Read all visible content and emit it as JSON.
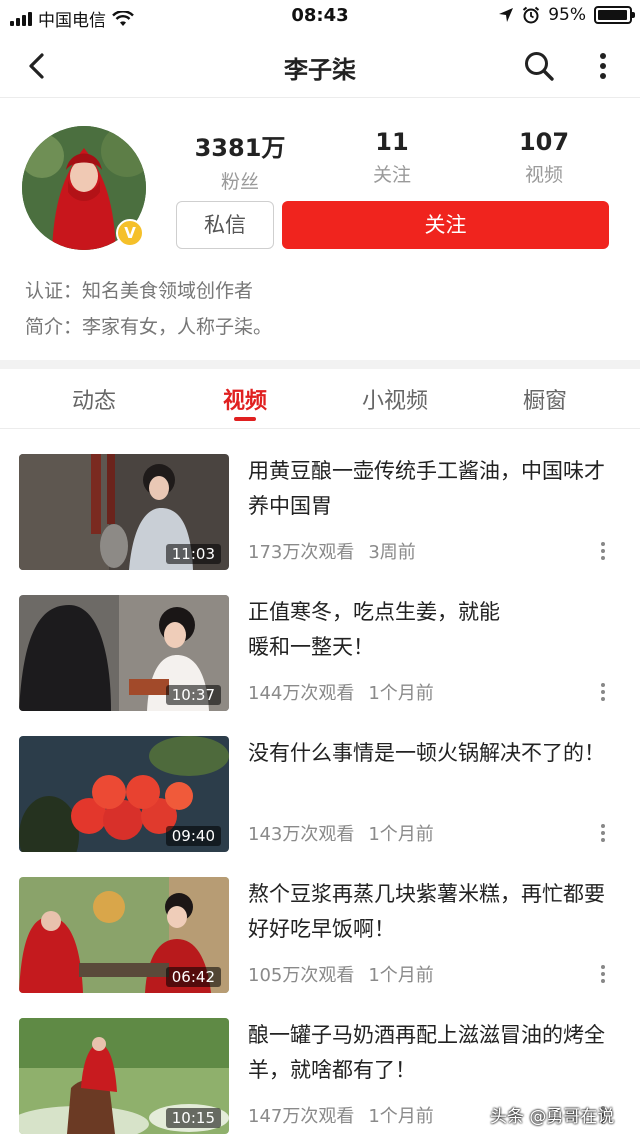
{
  "status_bar": {
    "carrier": "中国电信",
    "time": "08:43",
    "battery_percent": "95%",
    "battery_level": 0.95
  },
  "nav": {
    "title": "李子柒",
    "back_icon": "chevron-left-icon",
    "search_icon": "search-icon",
    "more_icon": "more-vertical-icon"
  },
  "profile": {
    "stats": [
      {
        "value": "3381万",
        "label": "粉丝"
      },
      {
        "value": "11",
        "label": "关注"
      },
      {
        "value": "107",
        "label": "视频"
      }
    ],
    "verified_mark": "V",
    "message_button": "私信",
    "follow_button": "关注",
    "certification": "认证：知名美食领域创作者",
    "intro": "简介：李家有女，人称子柒。"
  },
  "tabs": [
    {
      "label": "动态",
      "active": false
    },
    {
      "label": "视频",
      "active": true
    },
    {
      "label": "小视频",
      "active": false
    },
    {
      "label": "橱窗",
      "active": false
    }
  ],
  "videos": [
    {
      "title": "用黄豆酿一壶传统手工酱油，中国味才养中国胃",
      "duration": "11:03",
      "views": "173万次观看",
      "time": "3周前"
    },
    {
      "title": "正值寒冬，吃点生姜，就能\n暖和一整天！",
      "duration": "10:37",
      "views": "144万次观看",
      "time": "1个月前"
    },
    {
      "title": "没有什么事情是一顿火锅解决不了的！",
      "duration": "09:40",
      "views": "143万次观看",
      "time": "1个月前"
    },
    {
      "title": "熬个豆浆再蒸几块紫薯米糕，再忙都要好好吃早饭啊！",
      "duration": "06:42",
      "views": "105万次观看",
      "time": "1个月前"
    },
    {
      "title": "酿一罐子马奶酒再配上滋滋冒油的烤全羊，就啥都有了！",
      "duration": "10:15",
      "views": "147万次观看",
      "time": "1个月前"
    }
  ],
  "watermark": "头条 @勇哥在说",
  "colors": {
    "accent_red": "#f0241e",
    "text_primary": "#222222",
    "text_secondary": "#8a8a8a"
  }
}
